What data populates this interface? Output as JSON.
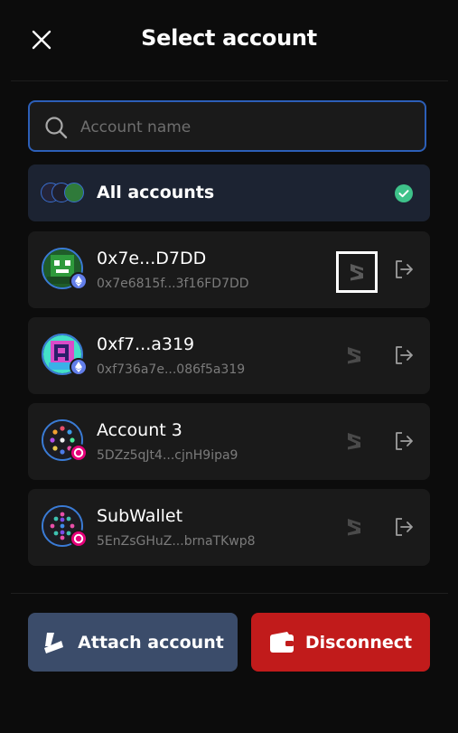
{
  "header": {
    "title": "Select account",
    "close_icon": "close-icon"
  },
  "search": {
    "placeholder": "Account name",
    "value": ""
  },
  "all_accounts": {
    "label": "All accounts",
    "selected": true,
    "check_color": "#3ec28a"
  },
  "accounts": [
    {
      "name": "0x7e...D7DD",
      "address": "0x7e6815f...3f16FD7DD",
      "network": "ethereum",
      "selected": true
    },
    {
      "name": "0xf7...a319",
      "address": "0xf736a7e...086f5a319",
      "network": "ethereum",
      "selected": false
    },
    {
      "name": "Account 3",
      "address": "5DZz5qJt4...cjnH9ipa9",
      "network": "polkadot",
      "selected": false
    },
    {
      "name": "SubWallet",
      "address": "5EnZsGHuZ...brnaTKwp8",
      "network": "polkadot",
      "selected": false
    }
  ],
  "footer": {
    "attach_label": "Attach account",
    "disconnect_label": "Disconnect",
    "attach_color": "#3b4c6a",
    "disconnect_color": "#c11b1b"
  },
  "colors": {
    "accent": "#2c5fb8",
    "background": "#0c0c0c",
    "card": "#1a1a1a",
    "polkadot": "#e6007a",
    "ethereum": "#627eea"
  }
}
